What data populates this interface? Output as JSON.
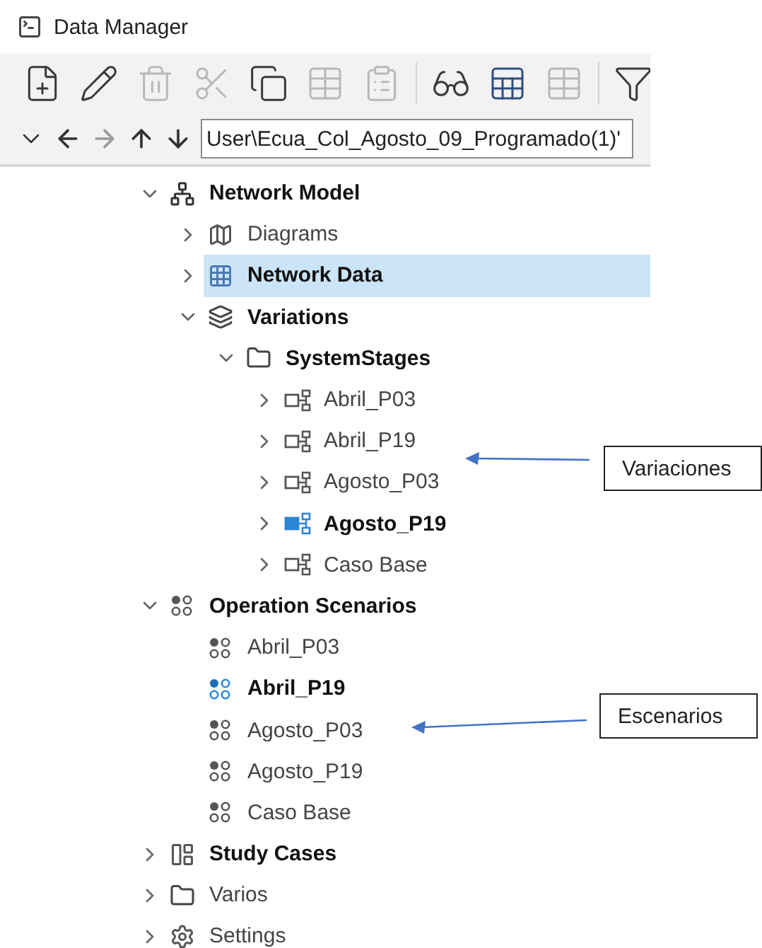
{
  "window": {
    "title": "Data Manager"
  },
  "toolbar": [
    {
      "kind": "new",
      "disabled": false
    },
    {
      "kind": "edit",
      "disabled": false
    },
    {
      "kind": "delete",
      "disabled": true
    },
    {
      "kind": "cut",
      "disabled": true
    },
    {
      "kind": "copy",
      "disabled": false
    },
    {
      "kind": "table",
      "disabled": true
    },
    {
      "kind": "paste",
      "disabled": true
    },
    {
      "kind": "view",
      "disabled": false
    },
    {
      "kind": "table-view",
      "disabled": false
    },
    {
      "kind": "table-alt",
      "disabled": true
    },
    {
      "kind": "filter",
      "disabled": false
    }
  ],
  "navigation": [
    {
      "kind": "down-chevron",
      "disabled": false
    },
    {
      "kind": "back",
      "disabled": false
    },
    {
      "kind": "forward",
      "disabled": true
    },
    {
      "kind": "up",
      "disabled": false
    },
    {
      "kind": "down",
      "disabled": false
    }
  ],
  "path_field": {
    "value": "User\\Ecua_Col_Agosto_09_Programado(1)'"
  },
  "tree": [
    {
      "label": "Network Model",
      "kind": "network",
      "bold": true,
      "selected": false,
      "expanded": true,
      "children": [
        {
          "label": "Diagrams",
          "kind": "diagram",
          "bold": false,
          "selected": false,
          "expanded": false
        },
        {
          "label": "Network Data",
          "kind": "grid",
          "bold": true,
          "selected": true,
          "expanded": false
        },
        {
          "label": "Variations",
          "kind": "variations",
          "bold": true,
          "selected": false,
          "expanded": true,
          "children": [
            {
              "label": "SystemStages",
              "kind": "folder",
              "bold": true,
              "selected": false,
              "expanded": true,
              "children": [
                {
                  "label": "Abril_P03",
                  "kind": "stage",
                  "bold": false,
                  "active": false,
                  "selected": false,
                  "expanded": false
                },
                {
                  "label": "Abril_P19",
                  "kind": "stage",
                  "bold": false,
                  "active": false,
                  "selected": false,
                  "expanded": false
                },
                {
                  "label": "Agosto_P03",
                  "kind": "stage",
                  "bold": false,
                  "active": false,
                  "selected": false,
                  "expanded": false
                },
                {
                  "label": "Agosto_P19",
                  "kind": "stage",
                  "bold": true,
                  "active": true,
                  "selected": false,
                  "expanded": false
                },
                {
                  "label": "Caso Base",
                  "kind": "stage",
                  "bold": false,
                  "active": false,
                  "selected": false,
                  "expanded": false
                }
              ]
            }
          ]
        }
      ]
    },
    {
      "label": "Operation Scenarios",
      "kind": "scenario",
      "bold": true,
      "selected": false,
      "expanded": true,
      "children": [
        {
          "label": "Abril_P03",
          "kind": "scenario",
          "bold": false,
          "active": false,
          "selected": false
        },
        {
          "label": "Abril_P19",
          "kind": "scenario",
          "bold": true,
          "active": true,
          "selected": false
        },
        {
          "label": "Agosto_P03",
          "kind": "scenario",
          "bold": false,
          "active": false,
          "selected": false
        },
        {
          "label": "Agosto_P19",
          "kind": "scenario",
          "bold": false,
          "active": false,
          "selected": false
        },
        {
          "label": "Caso Base",
          "kind": "scenario",
          "bold": false,
          "active": false,
          "selected": false
        }
      ]
    },
    {
      "label": "Study Cases",
      "kind": "study",
      "bold": true,
      "selected": false,
      "expanded": false
    },
    {
      "label": "Varios",
      "kind": "folder",
      "bold": false,
      "selected": false,
      "expanded": false
    },
    {
      "label": "Settings",
      "kind": "settings",
      "bold": false,
      "selected": false,
      "expanded": false
    }
  ],
  "callouts": [
    {
      "label": "Variaciones"
    },
    {
      "label": "Escenarios"
    }
  ]
}
